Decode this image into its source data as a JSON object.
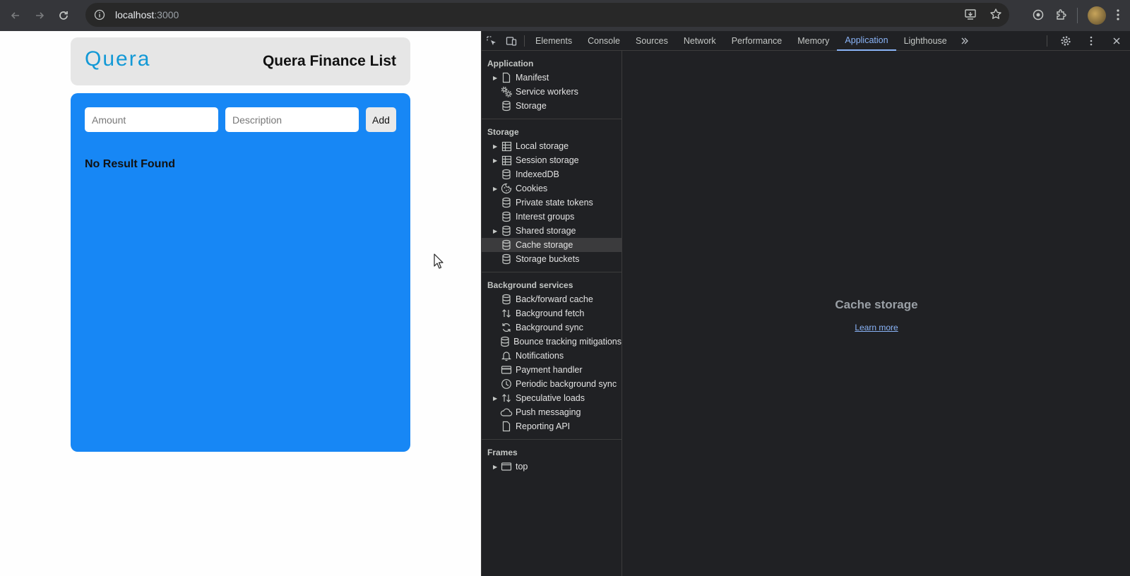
{
  "browser": {
    "url_host": "localhost",
    "url_port": ":3000"
  },
  "webpage": {
    "logo": "Quera",
    "title": "Quera Finance List",
    "amount_placeholder": "Amount",
    "description_placeholder": "Description",
    "add_label": "Add",
    "empty_text": "No Result Found"
  },
  "devtools": {
    "tabs": [
      "Elements",
      "Console",
      "Sources",
      "Network",
      "Performance",
      "Memory",
      "Application",
      "Lighthouse"
    ],
    "active_tab": "Application",
    "sections": [
      {
        "title": "Application",
        "items": [
          {
            "label": "Manifest",
            "icon": "file-icon",
            "expandable": true
          },
          {
            "label": "Service workers",
            "icon": "gears-icon",
            "expandable": false
          },
          {
            "label": "Storage",
            "icon": "database-icon",
            "expandable": false
          }
        ]
      },
      {
        "title": "Storage",
        "items": [
          {
            "label": "Local storage",
            "icon": "table-icon",
            "expandable": true
          },
          {
            "label": "Session storage",
            "icon": "table-icon",
            "expandable": true
          },
          {
            "label": "IndexedDB",
            "icon": "database-icon",
            "expandable": false
          },
          {
            "label": "Cookies",
            "icon": "cookie-icon",
            "expandable": true
          },
          {
            "label": "Private state tokens",
            "icon": "database-icon",
            "expandable": false
          },
          {
            "label": "Interest groups",
            "icon": "database-icon",
            "expandable": false
          },
          {
            "label": "Shared storage",
            "icon": "database-icon",
            "expandable": true
          },
          {
            "label": "Cache storage",
            "icon": "database-icon",
            "expandable": false,
            "selected": true
          },
          {
            "label": "Storage buckets",
            "icon": "database-icon",
            "expandable": false
          }
        ]
      },
      {
        "title": "Background services",
        "items": [
          {
            "label": "Back/forward cache",
            "icon": "database-icon",
            "expandable": false
          },
          {
            "label": "Background fetch",
            "icon": "updown-arrows-icon",
            "expandable": false
          },
          {
            "label": "Background sync",
            "icon": "sync-icon",
            "expandable": false
          },
          {
            "label": "Bounce tracking mitigations",
            "icon": "database-icon",
            "expandable": false
          },
          {
            "label": "Notifications",
            "icon": "bell-icon",
            "expandable": false
          },
          {
            "label": "Payment handler",
            "icon": "card-icon",
            "expandable": false
          },
          {
            "label": "Periodic background sync",
            "icon": "clock-icon",
            "expandable": false
          },
          {
            "label": "Speculative loads",
            "icon": "updown-arrows-icon",
            "expandable": true
          },
          {
            "label": "Push messaging",
            "icon": "cloud-icon",
            "expandable": false
          },
          {
            "label": "Reporting API",
            "icon": "file-icon",
            "expandable": false
          }
        ]
      },
      {
        "title": "Frames",
        "items": [
          {
            "label": "top",
            "icon": "frame-icon",
            "expandable": true
          }
        ]
      }
    ],
    "main_title": "Cache storage",
    "learn_more": "Learn more"
  }
}
